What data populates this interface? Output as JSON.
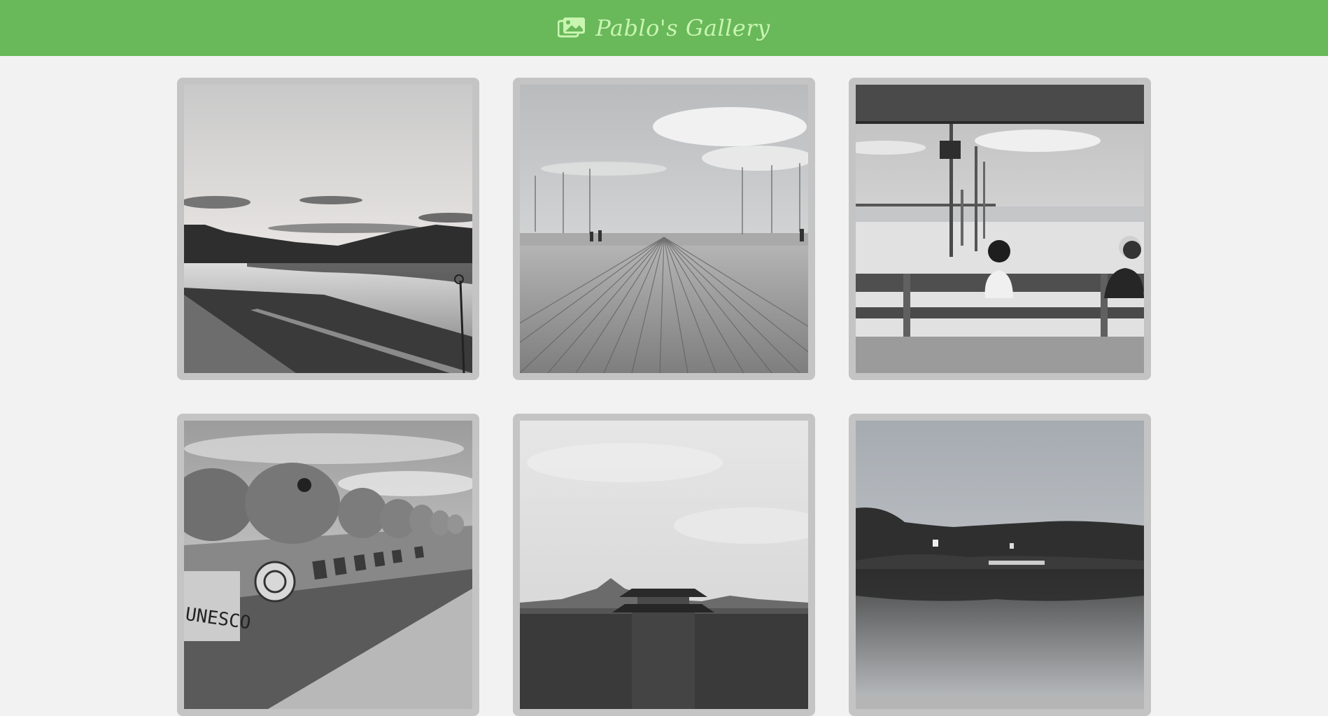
{
  "header": {
    "title": "Pablo's Gallery",
    "icon": "images-icon",
    "background_color": "#69b85a",
    "title_color": "#c8f5b0"
  },
  "gallery": {
    "items": [
      {
        "subject": "river-sunset-photo"
      },
      {
        "subject": "wooden-pier-photo"
      },
      {
        "subject": "beach-bench-photo"
      },
      {
        "subject": "stone-monument-photo",
        "caption_text": "UNESCO"
      },
      {
        "subject": "palace-mountain-photo"
      },
      {
        "subject": "lake-hills-photo"
      }
    ]
  }
}
